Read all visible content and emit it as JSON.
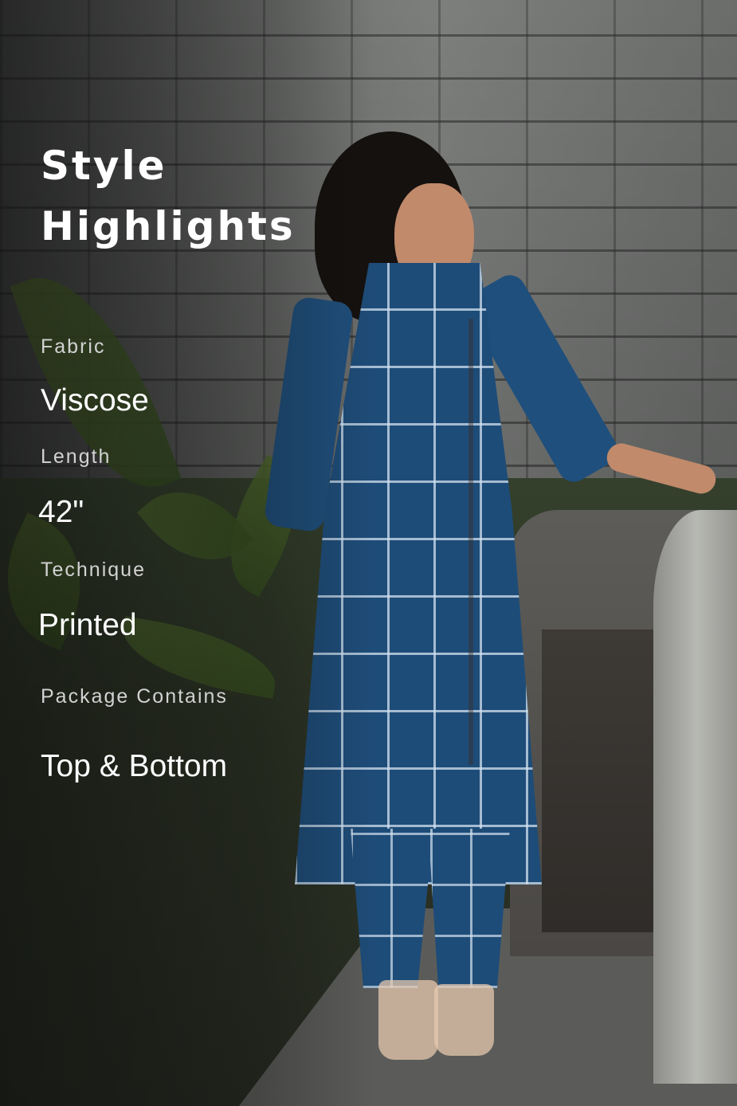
{
  "heading": {
    "line1": "Style",
    "line2": "Highlights"
  },
  "specs": [
    {
      "label": "Fabric",
      "value": "Viscose"
    },
    {
      "label": "Length",
      "value": "42\""
    },
    {
      "label": "Technique",
      "value": "Printed"
    },
    {
      "label": "Package Contains",
      "value": "Top & Bottom"
    }
  ],
  "colors": {
    "text_primary": "#ffffff",
    "text_secondary": "#d2d2d2",
    "garment": "#1e4c78"
  }
}
